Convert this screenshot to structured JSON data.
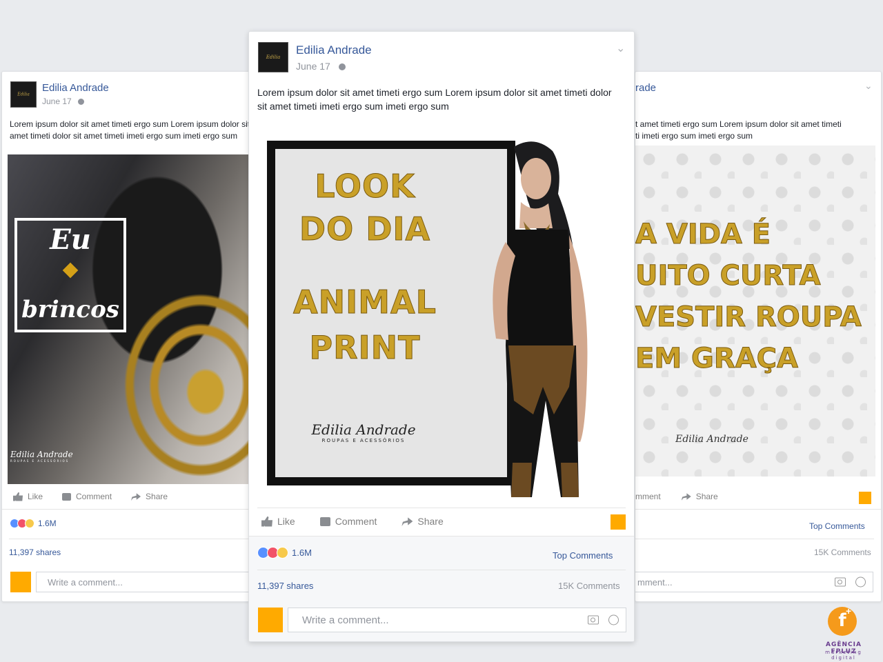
{
  "brand": {
    "accent": "#ffaa00",
    "link": "#365899",
    "gold": "#c9a028"
  },
  "posts": [
    {
      "author": "Edilia Andrade",
      "date": "June 17",
      "text": "Lorem ipsum dolor sit amet timeti ergo sum Lorem ipsum dolor sit amet timeti dolor sit amet timeti imeti ergo sum imeti ergo sum",
      "image": {
        "line1": "Eu",
        "line2": "brincos",
        "signature": "Edilia Andrade",
        "signature_sub": "ROUPAS E ACESSÓRIOS"
      },
      "actions": {
        "like": "Like",
        "comment": "Comment",
        "share": "Share"
      },
      "reaction_count": "1.6M",
      "shares": "11,397 shares",
      "comment_placeholder": "Write a comment..."
    },
    {
      "author": "Edilia Andrade",
      "date": "June 17",
      "text": "Lorem ipsum dolor sit amet timeti ergo sum Lorem ipsum dolor sit amet timeti dolor sit amet timeti imeti ergo sum imeti ergo sum",
      "image": {
        "line1": "LOOK",
        "line2": "DO DIA",
        "line3": "ANIMAL",
        "line4": "PRINT",
        "signature": "Edilia Andrade",
        "signature_sub": "ROUPAS E ACESSÓRIOS"
      },
      "actions": {
        "like": "Like",
        "comment": "Comment",
        "share": "Share"
      },
      "reaction_count": "1.6M",
      "top_comments": "Top Comments",
      "shares": "11,397 shares",
      "comments_count": "15K Comments",
      "comment_placeholder": "Write a comment..."
    },
    {
      "author_visible": "rade",
      "text_line1": "t amet timeti ergo sum Lorem ipsum dolor sit amet timeti",
      "text_line2": "ti imeti ergo sum imeti ergo sum",
      "image": {
        "line1": "A VIDA É",
        "line2": "UITO CURTA",
        "line3": "VESTIR ROUPA",
        "line4": "EM GRAÇA",
        "signature": "Edilia Andrade"
      },
      "actions": {
        "comment": "mment",
        "share": "Share"
      },
      "top_comments": "Top Comments",
      "comments_count": "15K Comments",
      "comment_placeholder": "mment..."
    }
  ],
  "agency": {
    "mark": "f",
    "plus": "+",
    "name": "AGÊNCIA FPLUZ",
    "tagline": "marketing digital"
  }
}
